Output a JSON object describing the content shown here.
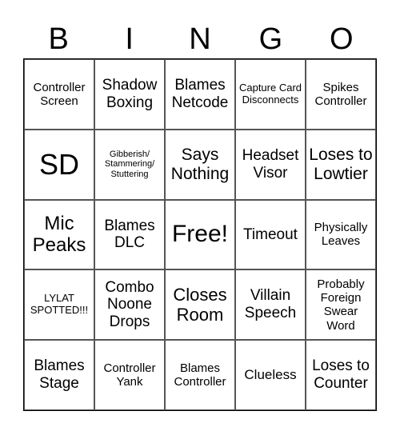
{
  "header": [
    "B",
    "I",
    "N",
    "G",
    "O"
  ],
  "cells": [
    {
      "text": "Controller Screen",
      "size": "s15"
    },
    {
      "text": "Shadow Boxing",
      "size": "s19"
    },
    {
      "text": "Blames Netcode",
      "size": "s19"
    },
    {
      "text": "Capture Card Disconnects",
      "size": "s13"
    },
    {
      "text": "Spikes Controller",
      "size": "s15"
    },
    {
      "text": "SD",
      "size": "s34"
    },
    {
      "text": "Gibberish/ Stammering/ Stuttering",
      "size": "s11"
    },
    {
      "text": "Says Nothing",
      "size": "s21"
    },
    {
      "text": "Headset Visor",
      "size": "s19"
    },
    {
      "text": "Loses to Lowtier",
      "size": "s21"
    },
    {
      "text": "Mic Peaks",
      "size": "s24"
    },
    {
      "text": "Blames DLC",
      "size": "s19"
    },
    {
      "text": "Free!",
      "size": "s30"
    },
    {
      "text": "Timeout",
      "size": "s19"
    },
    {
      "text": "Physically Leaves",
      "size": "s15"
    },
    {
      "text": "LYLAT SPOTTED!!!",
      "size": "s13"
    },
    {
      "text": "Combo Noone Drops",
      "size": "s19"
    },
    {
      "text": "Closes Room",
      "size": "s22"
    },
    {
      "text": "Villain Speech",
      "size": "s19"
    },
    {
      "text": "Probably Foreign Swear Word",
      "size": "s15"
    },
    {
      "text": "Blames Stage",
      "size": "s19"
    },
    {
      "text": "Controller Yank",
      "size": "s15"
    },
    {
      "text": "Blames Controller",
      "size": "s15"
    },
    {
      "text": "Clueless",
      "size": "s17"
    },
    {
      "text": "Loses to Counter",
      "size": "s19"
    }
  ]
}
